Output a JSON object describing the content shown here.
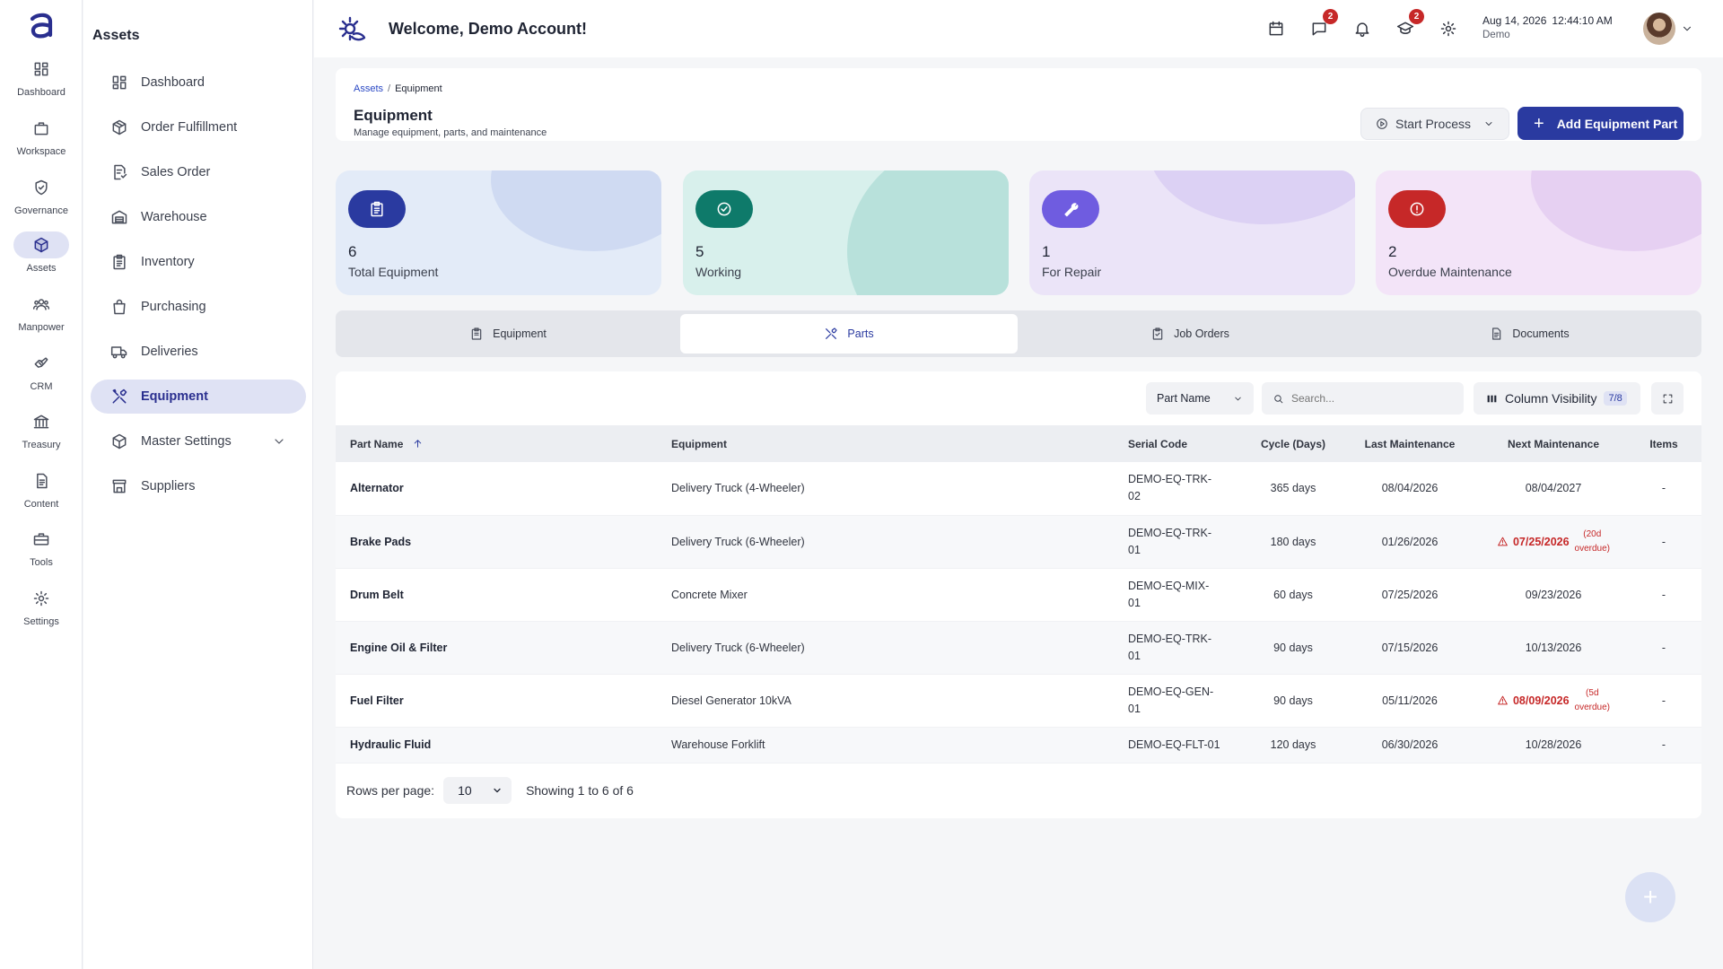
{
  "rail": {
    "items": [
      {
        "label": "Dashboard",
        "icon": "dashboard-icon"
      },
      {
        "label": "Workspace",
        "icon": "briefcase-icon"
      },
      {
        "label": "Governance",
        "icon": "shield-icon"
      },
      {
        "label": "Assets",
        "icon": "cube-icon"
      },
      {
        "label": "Manpower",
        "icon": "people-icon"
      },
      {
        "label": "CRM",
        "icon": "handshake-icon"
      },
      {
        "label": "Treasury",
        "icon": "bank-icon"
      },
      {
        "label": "Content",
        "icon": "document-icon"
      },
      {
        "label": "Tools",
        "icon": "toolbox-icon"
      },
      {
        "label": "Settings",
        "icon": "gear-icon"
      }
    ],
    "active": "Assets"
  },
  "sidebar": {
    "title": "Assets",
    "items": [
      {
        "label": "Dashboard"
      },
      {
        "label": "Order Fulfillment"
      },
      {
        "label": "Sales Order"
      },
      {
        "label": "Warehouse"
      },
      {
        "label": "Inventory"
      },
      {
        "label": "Purchasing"
      },
      {
        "label": "Deliveries"
      },
      {
        "label": "Equipment"
      },
      {
        "label": "Master Settings"
      },
      {
        "label": "Suppliers"
      }
    ],
    "active": "Equipment"
  },
  "header": {
    "welcome": "Welcome, Demo Account!",
    "messages_badge": "2",
    "training_badge": "2",
    "date": "Aug 14, 2026",
    "time": "12:44:10 AM",
    "subtitle": "Demo"
  },
  "page": {
    "breadcrumb": {
      "parent": "Assets",
      "separator": "/",
      "current": "Equipment"
    },
    "title": "Equipment",
    "subtitle": "Manage equipment, parts, and maintenance",
    "start_process_label": "Start Process",
    "add_button_label": "Add Equipment Part"
  },
  "stats": [
    {
      "value": "6",
      "label": "Total Equipment",
      "color": "#2a3aa0"
    },
    {
      "value": "5",
      "label": "Working",
      "color": "#0e7a6a"
    },
    {
      "value": "1",
      "label": "For Repair",
      "color": "#6f5ce0"
    },
    {
      "value": "2",
      "label": "Overdue Maintenance",
      "color": "#c62828"
    }
  ],
  "tabs": [
    {
      "label": "Equipment"
    },
    {
      "label": "Parts"
    },
    {
      "label": "Job Orders"
    },
    {
      "label": "Documents"
    }
  ],
  "active_tab": "Parts",
  "toolbar": {
    "filter_field": "Part Name",
    "search_placeholder": "Search...",
    "column_visibility_label": "Column Visibility",
    "column_visibility_count": "7/8"
  },
  "table": {
    "columns": [
      "Part Name",
      "Equipment",
      "Serial Code",
      "Cycle (Days)",
      "Last Maintenance",
      "Next Maintenance",
      "Items"
    ],
    "rows": [
      {
        "part": "Alternator",
        "equipment": "Delivery Truck (4-Wheeler)",
        "serial_1": "DEMO-EQ-TRK-",
        "serial_2": "02",
        "cycle": "365 days",
        "last": "08/04/2026",
        "next": "08/04/2027",
        "overdue_1": "",
        "overdue_2": "",
        "items": "-"
      },
      {
        "part": "Brake Pads",
        "equipment": "Delivery Truck (6-Wheeler)",
        "serial_1": "DEMO-EQ-TRK-",
        "serial_2": "01",
        "cycle": "180 days",
        "last": "01/26/2026",
        "next": "07/25/2026",
        "overdue_1": "(20d",
        "overdue_2": "overdue)",
        "items": "-"
      },
      {
        "part": "Drum Belt",
        "equipment": "Concrete Mixer",
        "serial_1": "DEMO-EQ-MIX-",
        "serial_2": "01",
        "cycle": "60 days",
        "last": "07/25/2026",
        "next": "09/23/2026",
        "overdue_1": "",
        "overdue_2": "",
        "items": "-"
      },
      {
        "part": "Engine Oil & Filter",
        "equipment": "Delivery Truck (6-Wheeler)",
        "serial_1": "DEMO-EQ-TRK-",
        "serial_2": "01",
        "cycle": "90 days",
        "last": "07/15/2026",
        "next": "10/13/2026",
        "overdue_1": "",
        "overdue_2": "",
        "items": "-"
      },
      {
        "part": "Fuel Filter",
        "equipment": "Diesel Generator 10kVA",
        "serial_1": "DEMO-EQ-GEN-",
        "serial_2": "01",
        "cycle": "90 days",
        "last": "05/11/2026",
        "next": "08/09/2026",
        "overdue_1": "(5d",
        "overdue_2": "overdue)",
        "items": "-"
      },
      {
        "part": "Hydraulic Fluid",
        "equipment": "Warehouse Forklift",
        "serial_1": "DEMO-EQ-FLT-01",
        "serial_2": "",
        "cycle": "120 days",
        "last": "06/30/2026",
        "next": "10/28/2026",
        "overdue_1": "",
        "overdue_2": "",
        "items": "-"
      }
    ]
  },
  "pagination": {
    "rows_per_page_label": "Rows per page:",
    "rows_per_page": "10",
    "showing": "Showing 1 to 6 of 6"
  },
  "fab": {
    "label": "+"
  }
}
